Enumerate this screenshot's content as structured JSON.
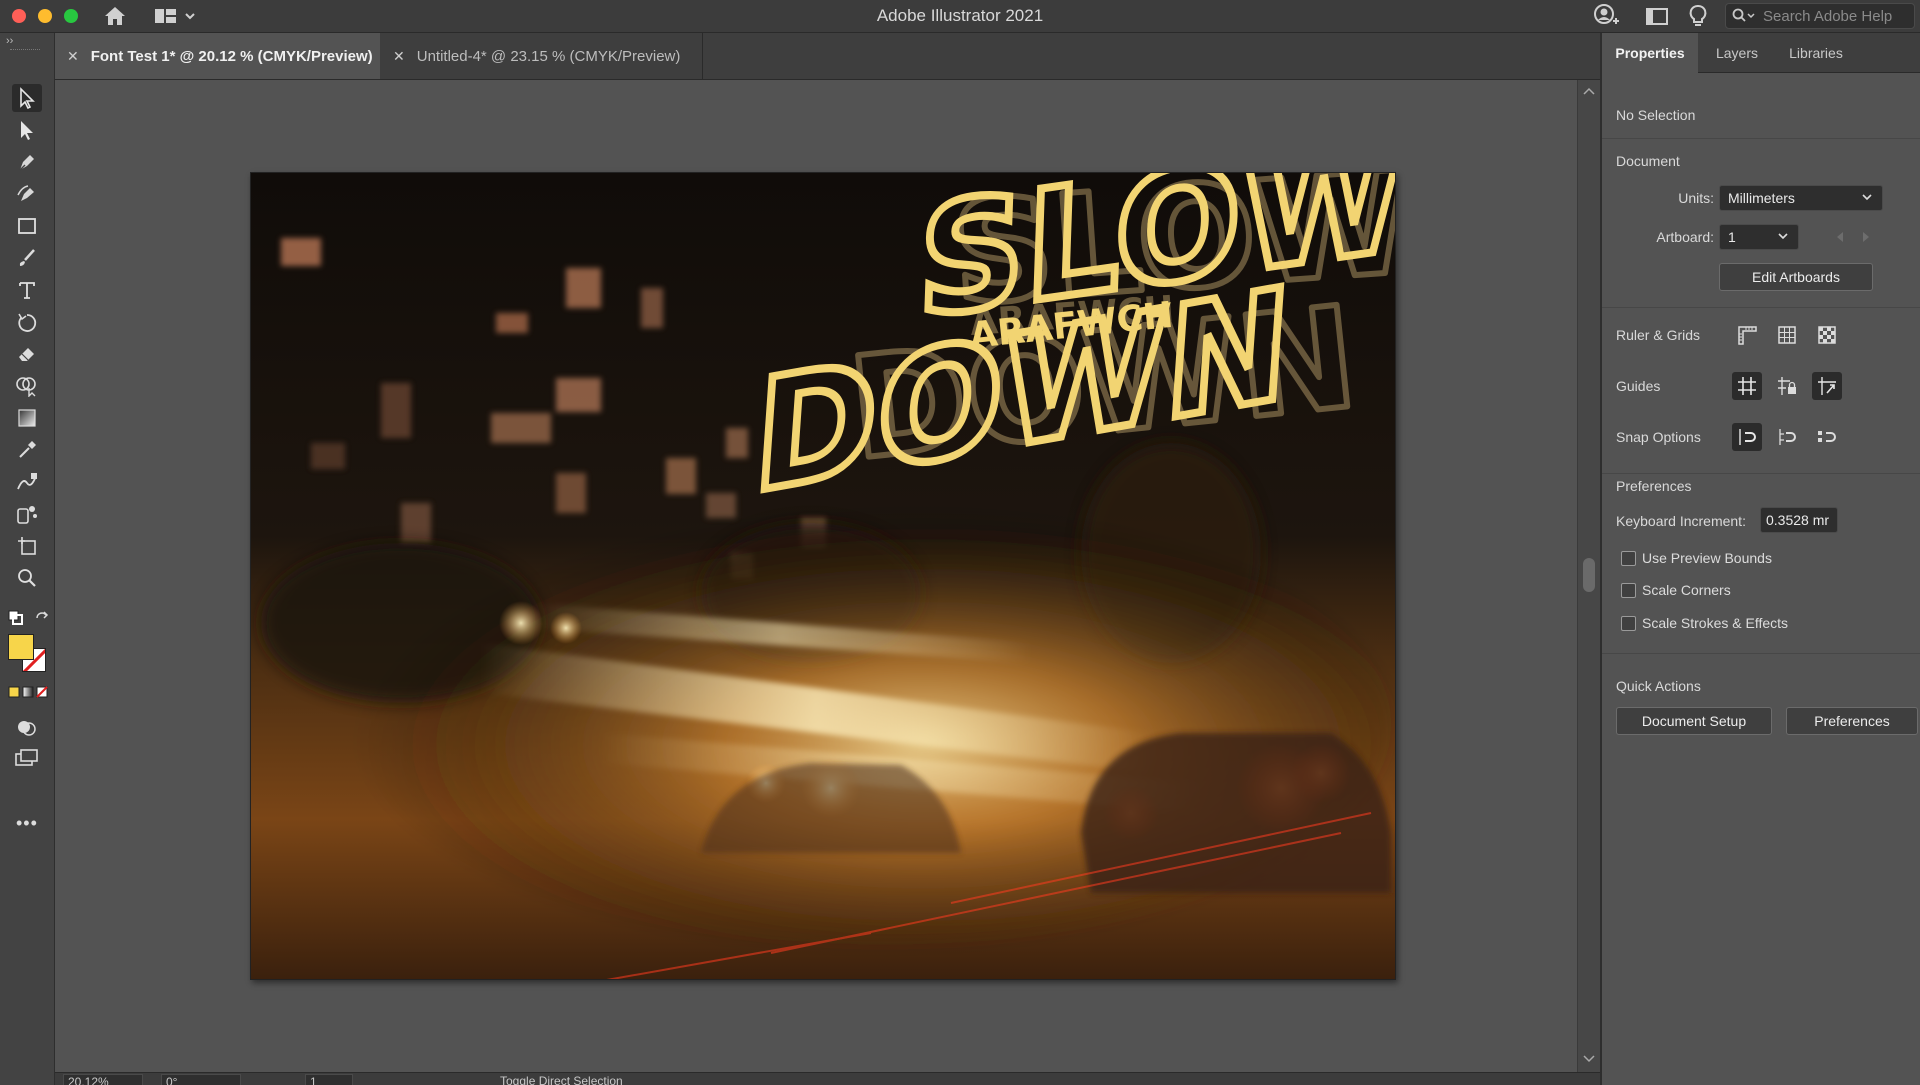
{
  "app": {
    "title": "Adobe Illustrator 2021"
  },
  "search": {
    "placeholder": "Search Adobe Help"
  },
  "doc_tabs": [
    {
      "label": "Font Test 1* @ 20.12 % (CMYK/Preview)",
      "active": true
    },
    {
      "label": "Untitled-4* @ 23.15 % (CMYK/Preview)",
      "active": false
    }
  ],
  "artwork": {
    "headline_top": "SLOW",
    "headline_bottom": "DOWN",
    "subtitle": "ARAFWCH",
    "text_color": "#f2d472"
  },
  "tools": [
    "selection-tool",
    "direct-selection-tool",
    "pen-tool",
    "curvature-tool",
    "rectangle-tool",
    "paintbrush-tool",
    "type-tool",
    "rotate-tool",
    "eraser-tool",
    "shape-builder-tool",
    "gradient-tool",
    "eyedropper-tool",
    "blend-tool",
    "symbol-sprayer-tool",
    "artboard-tool",
    "zoom-tool"
  ],
  "fill_color": "#f7d54a",
  "status": {
    "zoom": "20.12%",
    "rotation": "0°",
    "artboard": "1",
    "hint": "Toggle Direct Selection"
  },
  "panel": {
    "tabs": [
      "Properties",
      "Layers",
      "Libraries"
    ],
    "selection": "No Selection",
    "document": {
      "heading": "Document",
      "units_label": "Units:",
      "units_value": "Millimeters",
      "artboard_label": "Artboard:",
      "artboard_value": "1",
      "edit_artboards": "Edit Artboards"
    },
    "ruler_grids": "Ruler & Grids",
    "guides": "Guides",
    "snap_options": "Snap Options",
    "preferences": {
      "heading": "Preferences",
      "keyboard_increment_label": "Keyboard Increment:",
      "keyboard_increment_value": "0.3528 mr",
      "use_preview_bounds": "Use Preview Bounds",
      "scale_corners": "Scale Corners",
      "scale_strokes_effects": "Scale Strokes & Effects"
    },
    "quick_actions": {
      "heading": "Quick Actions",
      "document_setup": "Document Setup",
      "preferences": "Preferences"
    }
  }
}
